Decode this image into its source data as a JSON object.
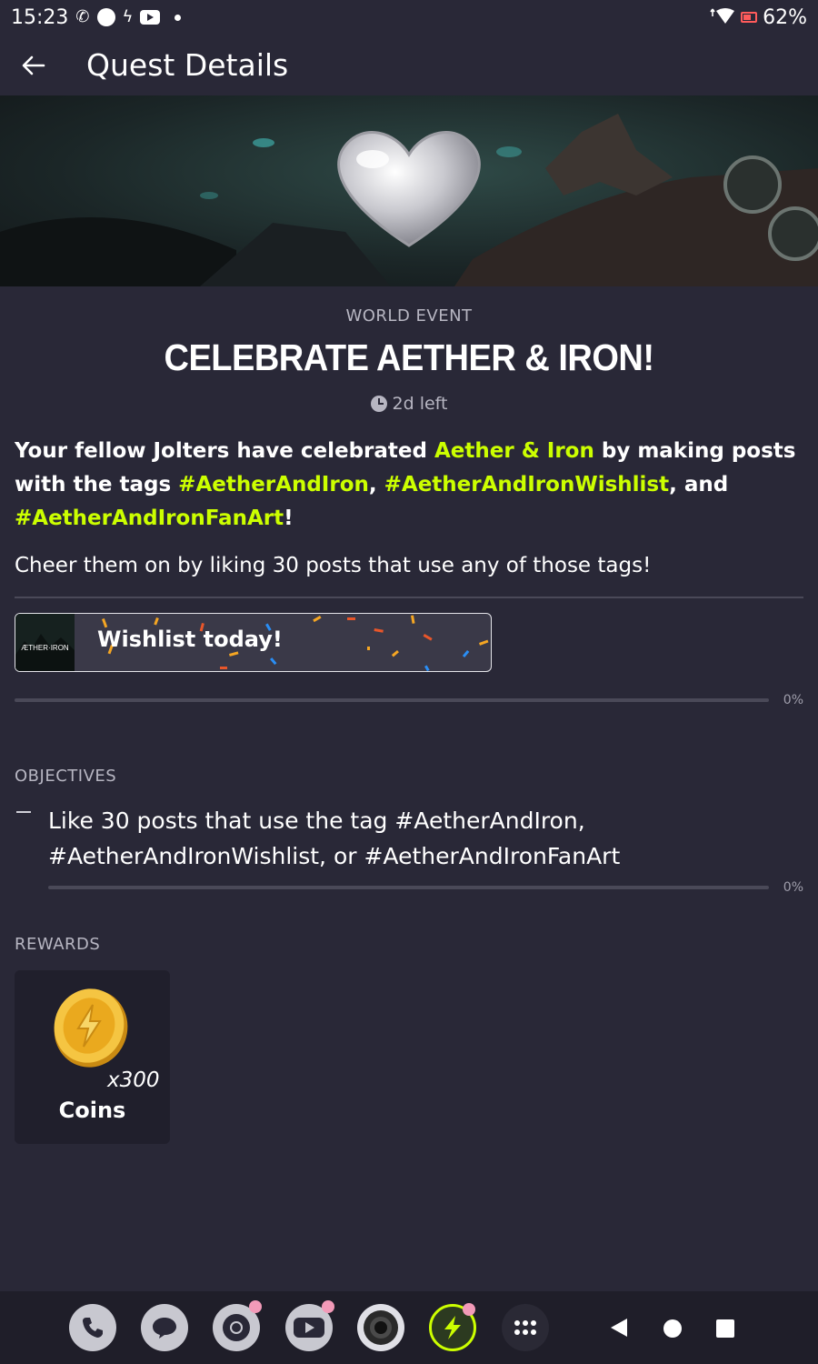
{
  "status_bar": {
    "time": "15:23",
    "battery": "62%"
  },
  "app_bar": {
    "title": "Quest Details"
  },
  "quest": {
    "type_label": "WORLD EVENT",
    "title": "CELEBRATE AETHER & IRON!",
    "time_left": "2d left",
    "description": {
      "part1": "Your fellow Jolters have celebrated ",
      "game_name": "Aether & Iron",
      "part2": " by making posts with the tags ",
      "tag1": "#AetherAndIron",
      "sep1": ", ",
      "tag2": "#AetherAndIronWishlist",
      "sep2": ", and ",
      "tag3": "#AetherAndIronFanArt",
      "part3": "!"
    },
    "cheer": "Cheer them on by liking 30 posts that use any of those tags!",
    "promo": {
      "label": "Wishlist today!",
      "thumb_logo": "ÆTHER·IRON"
    },
    "progress_percent": 0,
    "progress_label": "0%"
  },
  "objectives": {
    "heading": "OBJECTIVES",
    "items": [
      {
        "text": "Like 30 posts that use the tag #AetherAndIron, #AetherAndIronWishlist, or #AetherAndIronFanArt",
        "progress_percent": 0,
        "progress_label": "0%"
      }
    ]
  },
  "rewards": {
    "heading": "REWARDS",
    "items": [
      {
        "icon": "coin-icon",
        "multiplier": "x300",
        "name": "Coins"
      }
    ]
  },
  "nav_bar": {
    "apps": [
      "phone-icon",
      "messages-icon",
      "chrome-icon",
      "youtube-icon",
      "camera-icon",
      "game-jolt-icon",
      "app-drawer-icon"
    ],
    "system": [
      "back-icon",
      "home-icon",
      "recents-icon"
    ]
  },
  "colors": {
    "background": "#292837",
    "accent": "#ccff00",
    "muted_text": "#b7b6c2",
    "card": "#201f2c"
  }
}
